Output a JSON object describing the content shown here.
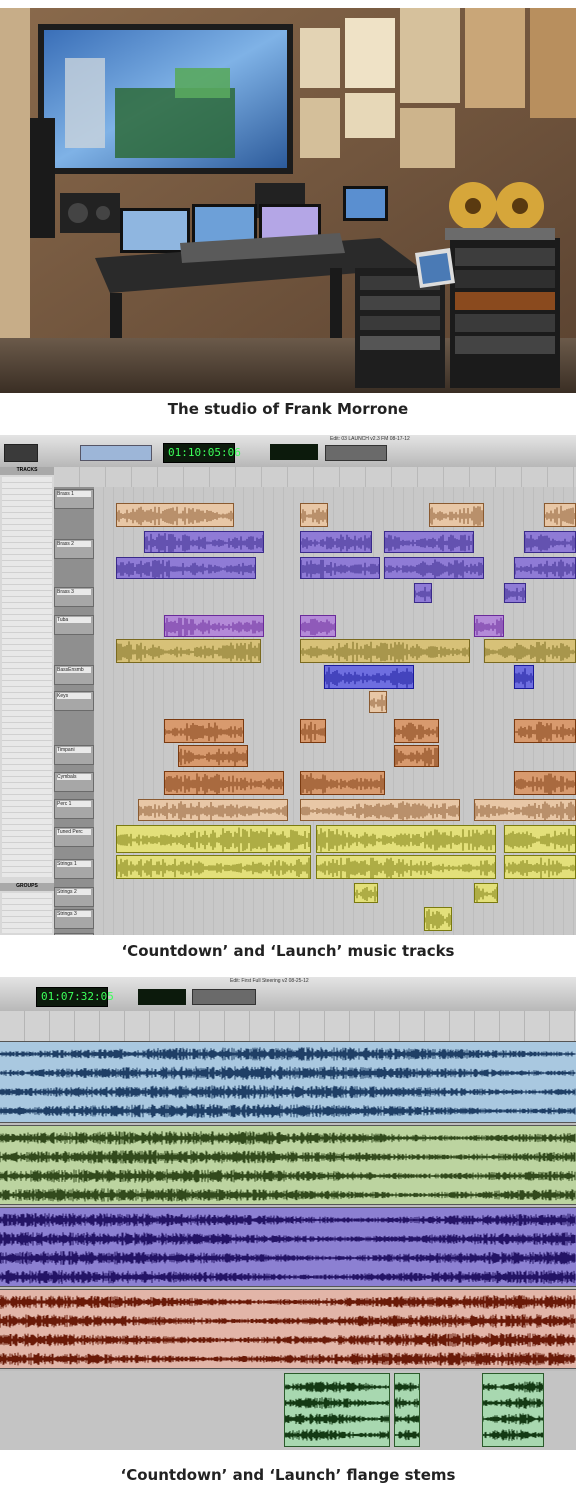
{
  "captions": {
    "studio": "The studio of Frank Morrone",
    "music_tracks": "‘Countdown’ and ‘Launch’ music tracks",
    "flange_stems": "‘Countdown’ and ‘Launch’ flange stems"
  },
  "session1": {
    "window_title": "Edit: 03 LAUNCH v2.3 FM 08-17-12",
    "main_counter": "01:10:05:06",
    "tracks_label": "TRACKS",
    "groups_label": "GROUPS",
    "track_names": [
      "Brass 1",
      "Brass 2",
      "Brass 3",
      "Tuba",
      "BassEnsmb",
      "Keys",
      "Timpani",
      "Cymbals",
      "Perc 1",
      "Tuned Perc",
      "Strings 1",
      "Strings 2",
      "Strings 3",
      "Strings 4"
    ],
    "group_names": [
      "<ALL>",
      "Brass",
      "all brass",
      "Strings Brass",
      "Wood Inst Brass",
      "Dub Perc",
      "Bass Ensemble"
    ]
  },
  "session2": {
    "window_title": "Edit: First Full Steering v2 08-25-12",
    "main_counter": "01:07:32:05"
  },
  "colors": {
    "counter_green": "#3cff5a",
    "brass_orange": "#e8c7a6",
    "brass_purple": "#8f7bd6",
    "tuba_violet": "#b48ad8",
    "bass_olive": "#d7c178",
    "keys_blue": "#6e6ee0",
    "perc_orange": "#d89a6e",
    "strings_yellow": "#e3e07a",
    "stem_blue": "#a9c8e0",
    "stem_green": "#bcd4a0",
    "stem_purple": "#8c80d2",
    "stem_red": "#e2b5a8",
    "stem_mint": "#a8d8b0"
  }
}
